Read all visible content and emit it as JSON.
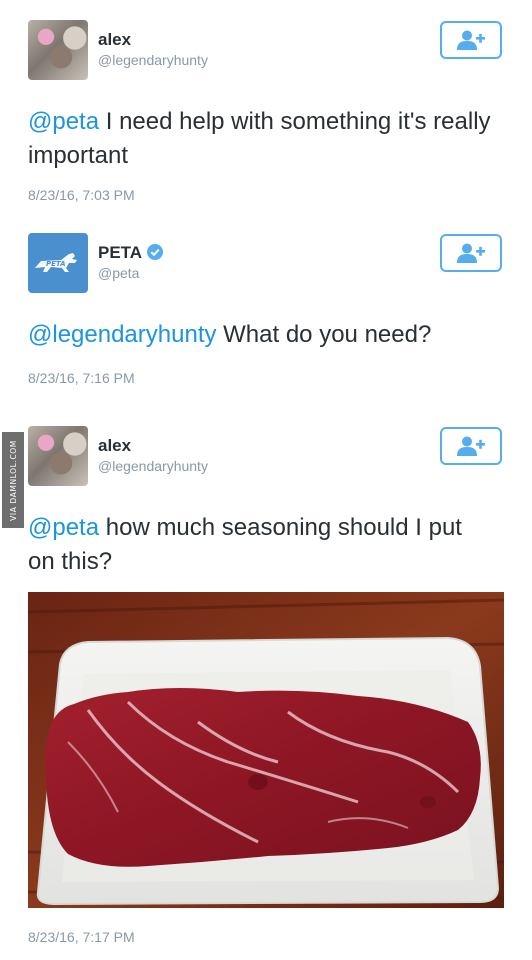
{
  "tweets": [
    {
      "name": "alex",
      "handle": "@legendaryhunty",
      "mention": "@peta",
      "body": " I need help with something it's really important",
      "timestamp": "8/23/16, 7:03 PM"
    },
    {
      "name": "PETA",
      "handle": "@peta",
      "mention": "@legendaryhunty",
      "body": " What do you need?",
      "timestamp": "8/23/16, 7:16 PM",
      "verified": true,
      "logo_text": "PETA"
    },
    {
      "name": "alex",
      "handle": "@legendaryhunty",
      "mention": "@peta",
      "body": " how much seasoning should I put on this?",
      "timestamp": "8/23/16, 7:17 PM"
    }
  ],
  "watermark": "VIA DAMNLOL.COM",
  "icons": {
    "follow": "add-user-icon",
    "verified": "verified-badge-icon",
    "photo": "steak-photo"
  },
  "colors": {
    "link": "#1c94e0",
    "accent": "#55acee",
    "muted": "#8899a6",
    "peta_blue": "#4a90cf"
  }
}
